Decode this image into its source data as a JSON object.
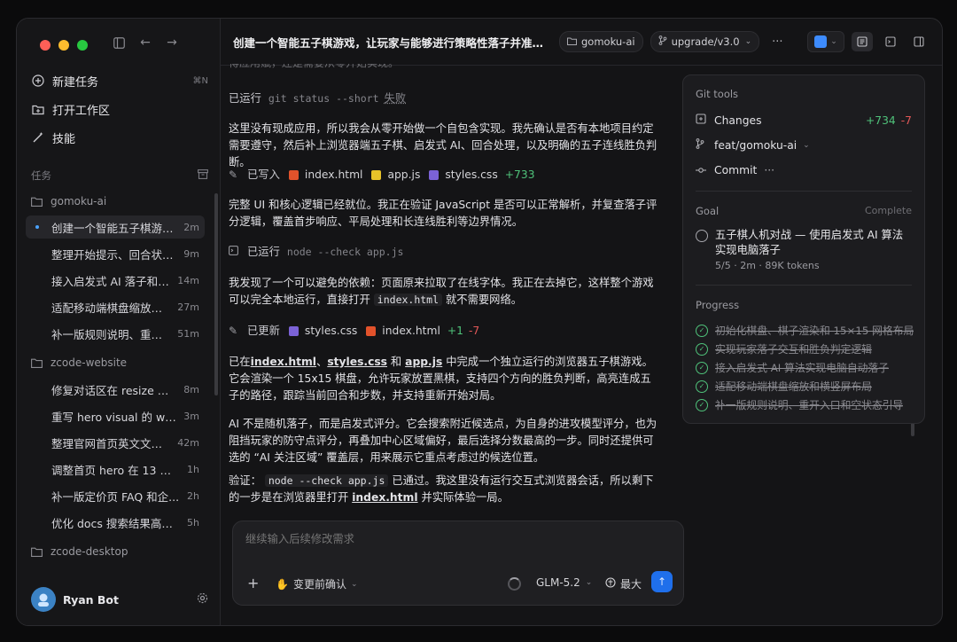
{
  "sidebar": {
    "new_task": "新建任务",
    "new_task_shortcut": "⌘N",
    "open_workspace": "打开工作区",
    "skills": "技能",
    "tasks_label": "任务",
    "groups": [
      {
        "name": "gomoku-ai",
        "tasks": [
          {
            "name": "创建一个智能五子棋游戏...",
            "time": "2m",
            "active": true
          },
          {
            "name": "整理开始提示、回合状态...",
            "time": "9m"
          },
          {
            "name": "接入启发式 AI 落子和玩...",
            "time": "14m"
          },
          {
            "name": "适配移动端棋盘缩放和...",
            "time": "27m"
          },
          {
            "name": "补一版规则说明、重开...",
            "time": "51m"
          }
        ]
      },
      {
        "name": "zcode-website",
        "tasks": [
          {
            "name": "修复对话区在 resize 时...",
            "time": "8m"
          },
          {
            "name": "重写 hero visual 的 work...",
            "time": "3m"
          },
          {
            "name": "整理官网首页英文文案...",
            "time": "42m"
          },
          {
            "name": "调整首页 hero 在 13 寸和...",
            "time": "1h"
          },
          {
            "name": "补一版定价页 FAQ 和企...",
            "time": "2h"
          },
          {
            "name": "优化 docs 搜索结果高亮...",
            "time": "5h"
          }
        ]
      },
      {
        "name": "zcode-desktop",
        "tasks": []
      }
    ],
    "user_name": "Ryan Bot"
  },
  "topbar": {
    "title": "创建一个智能五子棋游戏，让玩家与能够进行策略性落子并准确判断...",
    "workspace_chip": "gomoku-ai",
    "branch_chip": "upgrade/v3.0",
    "more": "···"
  },
  "conversation": {
    "faded_top": "得应用赋，还是需要从零开始实现。",
    "ran1_label": "已运行",
    "ran1_cmd": "git status --short",
    "ran1_status": "失败",
    "p1": "这里没有现成应用，所以我会从零开始做一个自包含实现。我先确认是否有本地项目约定需要遵守，然后补上浏览器端五子棋、启发式 AI、回合处理，以及明确的五子连线胜负判断。",
    "write_label": "已写入",
    "write_files": [
      "index.html",
      "app.js",
      "styles.css"
    ],
    "write_add": "+733",
    "p2": "完整 UI 和核心逻辑已经就位。我正在验证 JavaScript 是否可以正常解析，并复查落子评分逻辑，覆盖首步响应、平局处理和长连线胜利等边界情况。",
    "ran2_label": "已运行",
    "ran2_cmd": "node --check app.js",
    "p3_a": "我发现了一个可以避免的依赖：页面原来拉取了在线字体。我正在去掉它，这样整个游戏可以完全本地运行，直接打开",
    "p3_code": "index.html",
    "p3_b": "就不需要网络。",
    "update_label": "已更新",
    "update_files": [
      "styles.css",
      "index.html"
    ],
    "update_add": "+1",
    "update_del": "-7",
    "p4_a": "已在",
    "p4_l1": "index.html",
    "p4_s1": "、",
    "p4_l2": "styles.css",
    "p4_s2": "和",
    "p4_l3": "app.js",
    "p4_b": "中完成一个独立运行的浏览器五子棋游戏。它会渲染一个 15x15 棋盘，允许玩家放置黑棋，支持四个方向的胜负判断，高亮连成五子的路径，跟踪当前回合和步数，并支持重新开始对局。",
    "p5": "AI 不是随机落子，而是启发式评分。它会搜索附近候选点，为自身的进攻模型评分，也为阻挡玩家的防守点评分，再叠加中心区域偏好，最后选择分数最高的一步。同时还提供可选的 “AI 关注区域” 覆盖层，用来展示它重点考虑过的候选位置。",
    "p6_a": "验证：",
    "p6_code": "node --check app.js",
    "p6_b": "已通过。我这里没有运行交互式浏览器会话，所以剩下的一步是在浏览器里打开",
    "p6_link": "index.html",
    "p6_c": "并实际体验一局。"
  },
  "panel": {
    "git_header": "Git tools",
    "changes_label": "Changes",
    "changes_add": "+734",
    "changes_del": "-7",
    "branch": "feat/gomoku-ai",
    "commit_label": "Commit",
    "commit_more": "···",
    "goal_header": "Goal",
    "goal_status": "Complete",
    "goal_text": "五子棋人机对战 — 使用启发式 AI 算法实现电脑落子",
    "goal_meta": "5/5 · 2m · 89K tokens",
    "progress_header": "Progress",
    "progress_items": [
      "初始化棋盘、棋子渲染和 15×15 网格布局",
      "实现玩家落子交互和胜负判定逻辑",
      "接入启发式 AI 算法实现电脑自动落子",
      "适配移动端棋盘缩放和横竖屏布局",
      "补一版规则说明、重开入口和空状态引导"
    ]
  },
  "composer": {
    "placeholder": "继续输入后续修改需求",
    "mode": "变更前确认",
    "model": "GLM-5.2",
    "effort": "最大"
  },
  "colors": {
    "accent": "#1f6feb",
    "add": "#4fc27a",
    "del": "#e05757"
  }
}
